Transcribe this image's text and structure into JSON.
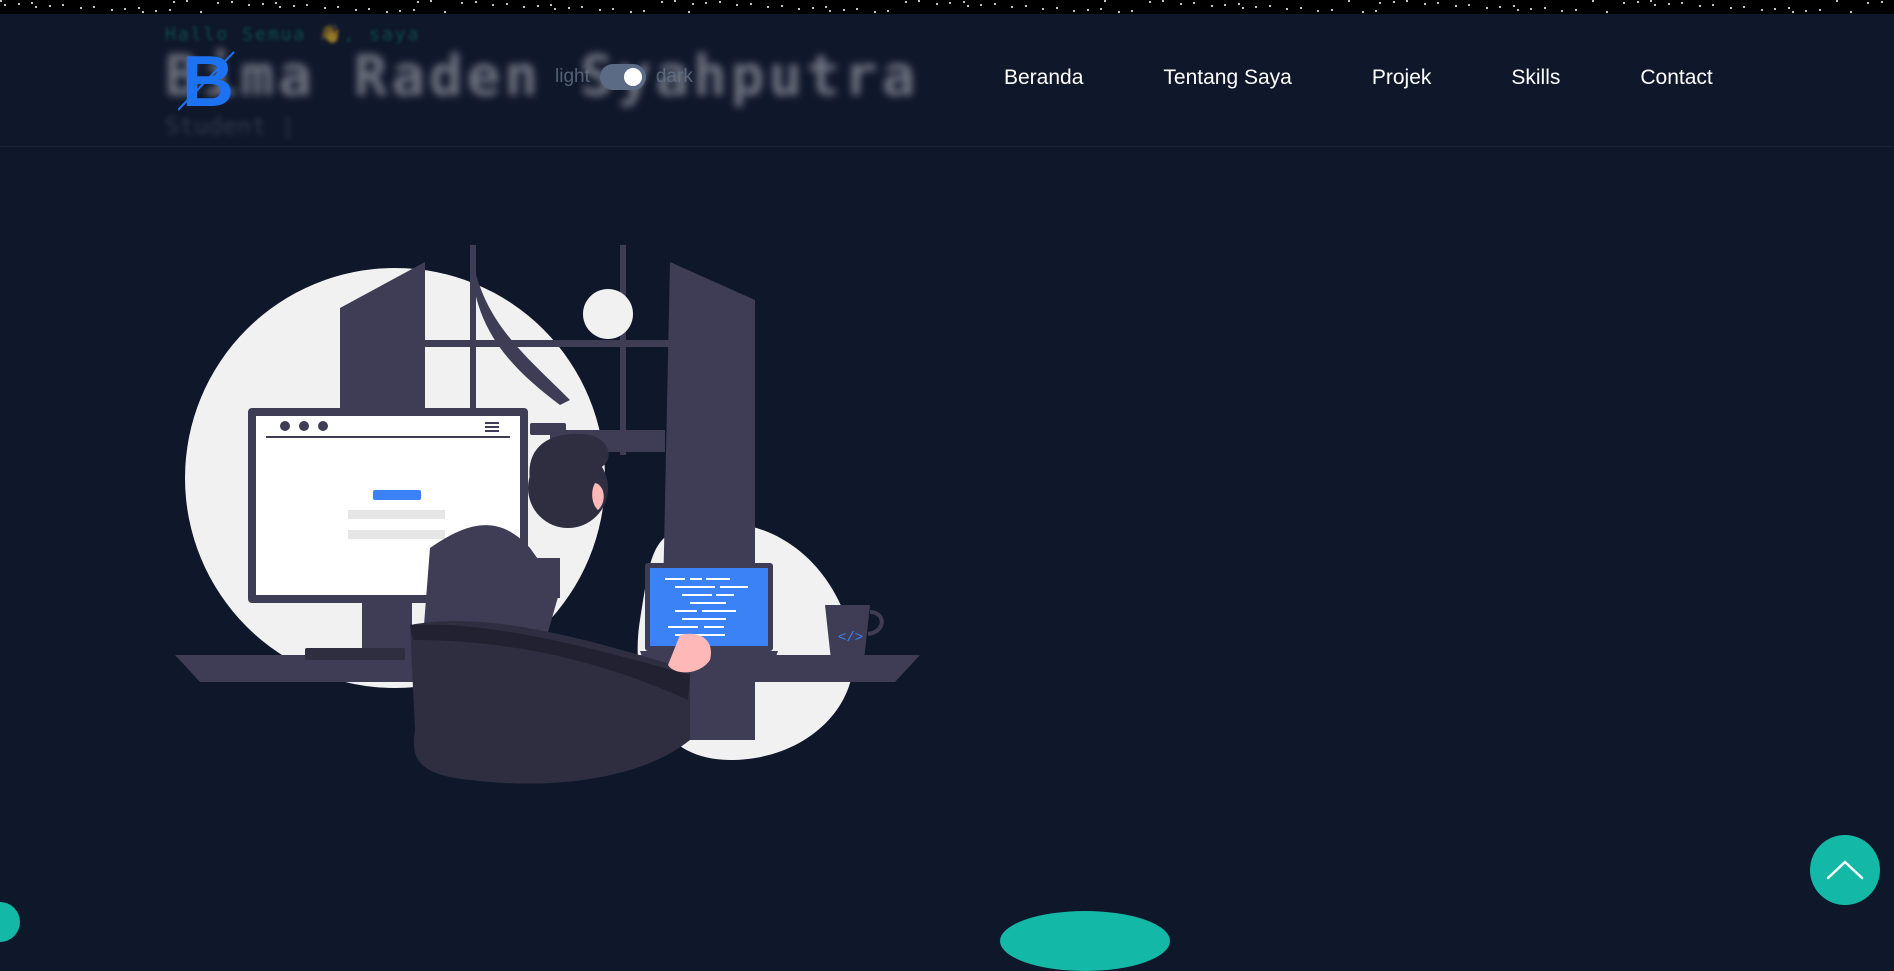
{
  "header": {
    "greeting": "Hallo Semua 👋, saya",
    "name": "Bima Raden Syahputra",
    "role": "Student |",
    "logo_letter": "B"
  },
  "theme": {
    "light_label": "light",
    "dark_label": "dark",
    "mode": "dark"
  },
  "nav": {
    "items": [
      {
        "label": "Beranda"
      },
      {
        "label": "Tentang Saya"
      },
      {
        "label": "Projek"
      },
      {
        "label": "Skills"
      },
      {
        "label": "Contact"
      }
    ]
  },
  "illustration": {
    "icon": "developer-at-desk-illustration",
    "cup_label": "</>"
  },
  "scroll_top": {
    "icon": "chevron-up-icon"
  },
  "colors": {
    "background": "#0f172a",
    "accent": "#14b8a6",
    "logo": "#1d72f2",
    "screen_blue": "#3b82f6"
  }
}
